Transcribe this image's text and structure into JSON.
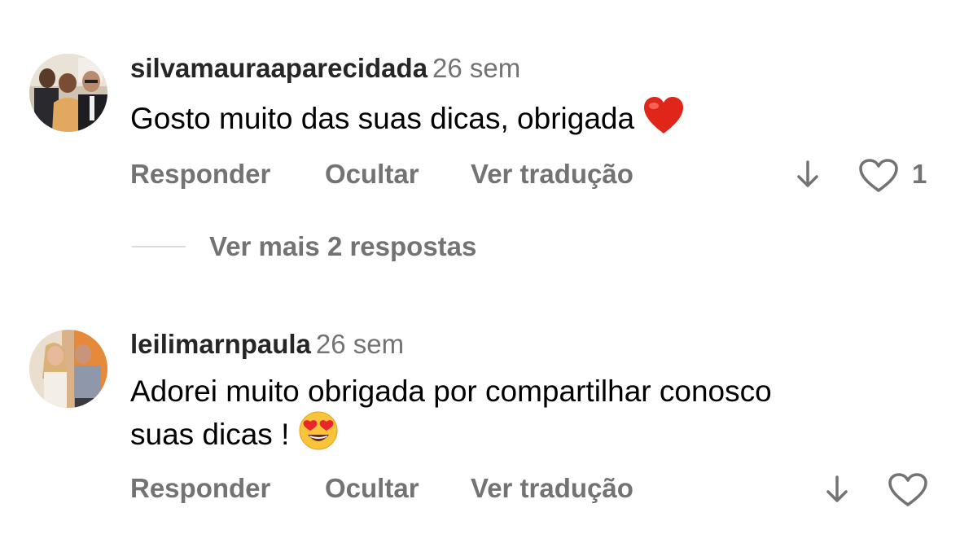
{
  "comments": [
    {
      "username": "silvamauraaparecidada",
      "time": "26 sem",
      "text": "Gosto muito das suas dicas, obrigada",
      "text_emoji": "red-heart",
      "actions": {
        "reply": "Responder",
        "hide": "Ocultar",
        "translate": "Ver tradução"
      },
      "likes": "1"
    },
    {
      "username": "leilimarnpaula",
      "time": "26 sem",
      "text_line1": "Adorei muito obrigada por compartilhar conosco",
      "text_line2": "suas dicas !",
      "text_emoji": "heart-eyes",
      "actions": {
        "reply": "Responder",
        "hide": "Ocultar",
        "translate": "Ver tradução"
      }
    }
  ],
  "view_replies": "Ver mais 2 respostas",
  "colors": {
    "username": "#262626",
    "secondary_text": "#737373",
    "divider": "#dbdbdb"
  },
  "icons": [
    "down-arrow-icon",
    "heart-outline-icon",
    "red-heart-emoji",
    "heart-eyes-emoji"
  ]
}
